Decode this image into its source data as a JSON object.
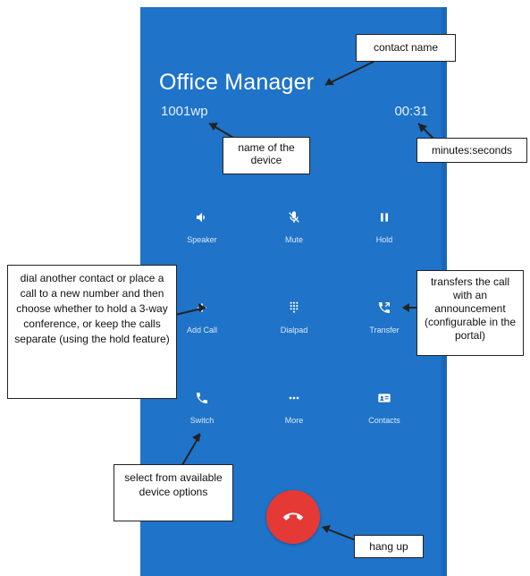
{
  "call": {
    "contact_name": "Office Manager",
    "device_name": "1001wp",
    "timer": "00:31"
  },
  "controls": [
    {
      "label": "Speaker",
      "icon": "speaker-icon"
    },
    {
      "label": "Mute",
      "icon": "mic-off-icon"
    },
    {
      "label": "Hold",
      "icon": "pause-icon"
    },
    {
      "label": "Add Call",
      "icon": "plus-icon"
    },
    {
      "label": "Dialpad",
      "icon": "dialpad-icon"
    },
    {
      "label": "Transfer",
      "icon": "phone-transfer-icon"
    },
    {
      "label": "Switch",
      "icon": "phone-icon"
    },
    {
      "label": "More",
      "icon": "more-dots-icon"
    },
    {
      "label": "Contacts",
      "icon": "contact-card-icon"
    }
  ],
  "hangup": {
    "icon": "hang-up-icon",
    "color": "#e53935"
  },
  "annotations": {
    "contact_name": "contact name",
    "device_name": "name of the device",
    "timer": "minutes:seconds",
    "add_call": "dial another contact or place a call to a new number and then choose whether to hold a 3-way conference, or keep the calls separate (using the hold feature)",
    "transfer": "transfers the call with an announcement (configurable in the portal)",
    "switch": "select from available device options",
    "hang_up": "hang up"
  },
  "colors": {
    "background": "#1f73c8",
    "text": "#ffffff",
    "hangup": "#e53935"
  }
}
